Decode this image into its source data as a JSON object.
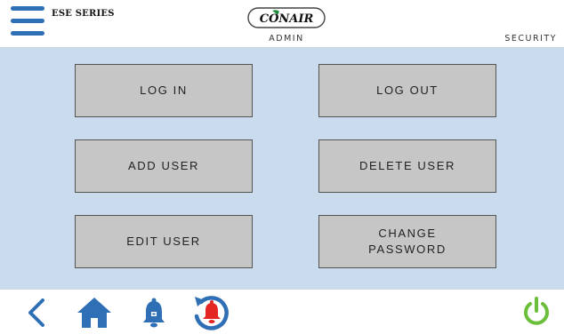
{
  "header": {
    "series": "ESE SERIES",
    "logo_text": "CONAIR",
    "mode": "ADMIN",
    "section": "SECURITY"
  },
  "buttons": {
    "login": "LOG IN",
    "logout": "LOG OUT",
    "add_user": "ADD USER",
    "delete_user": "DELETE USER",
    "edit_user": "EDIT USER",
    "change_password": "CHANGE\nPASSWORD"
  },
  "footer": {
    "icons": [
      "back-arrow-icon",
      "home-icon",
      "alarm-bell-icon",
      "alarm-history-icon",
      "power-icon"
    ]
  },
  "colors": {
    "accent_blue": "#2f6fb5",
    "main_background": "#c9dbed",
    "button_fill": "#c6c6c6",
    "alarm_red": "#e52521",
    "power_green": "#6cbf3a",
    "logo_green": "#1f8a3a"
  }
}
